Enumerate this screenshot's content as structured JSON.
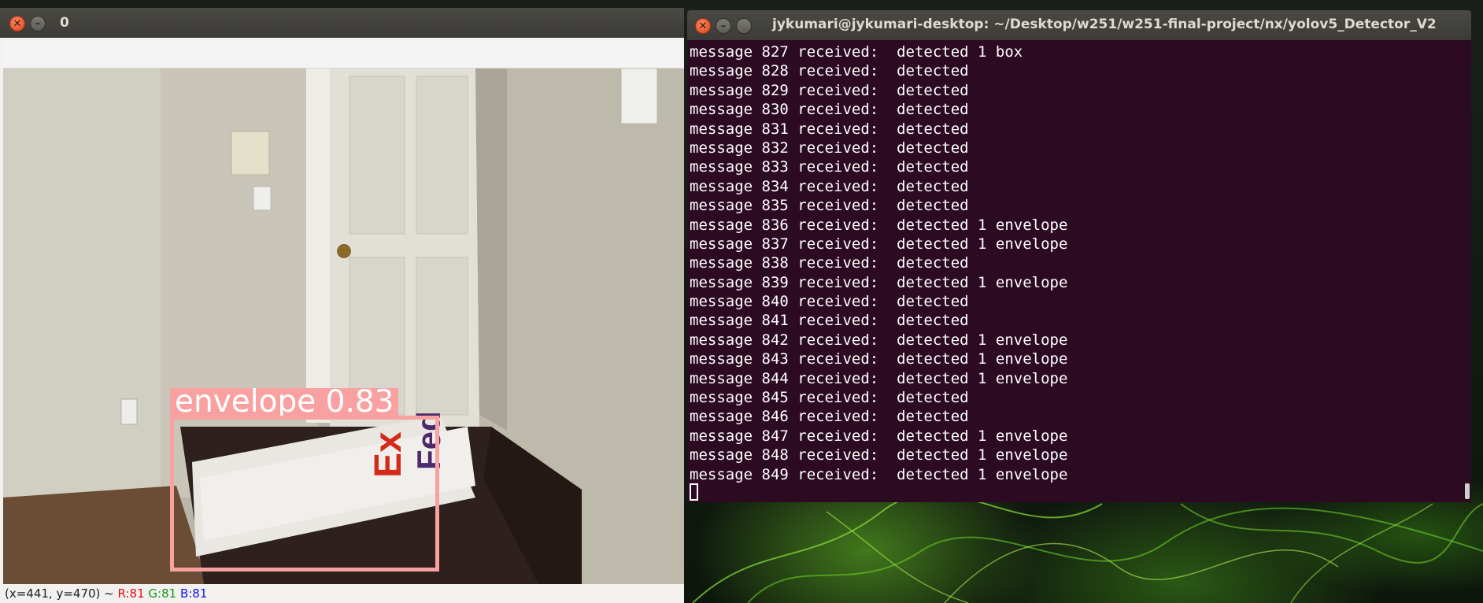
{
  "viewer": {
    "title": "0",
    "close_glyph": "✕",
    "minimize_glyph": "–",
    "detection": {
      "label": "envelope 0.83",
      "color": "#f8a1a0"
    },
    "status": {
      "coords": "(x=441, y=470) ~",
      "r": "R:81",
      "g": "G:81",
      "b": "B:81"
    }
  },
  "terminal": {
    "title": "jykumari@jykumari-desktop: ~/Desktop/w251/w251-final-project/nx/yolov5_Detector_V2",
    "background": "#2c0a22",
    "lines": [
      "message 827 received:  detected 1 box",
      "message 828 received:  detected",
      "message 829 received:  detected",
      "message 830 received:  detected",
      "message 831 received:  detected",
      "message 832 received:  detected",
      "message 833 received:  detected",
      "message 834 received:  detected",
      "message 835 received:  detected",
      "message 836 received:  detected 1 envelope",
      "message 837 received:  detected 1 envelope",
      "message 838 received:  detected",
      "message 839 received:  detected 1 envelope",
      "message 840 received:  detected",
      "message 841 received:  detected",
      "message 842 received:  detected 1 envelope",
      "message 843 received:  detected 1 envelope",
      "message 844 received:  detected 1 envelope",
      "message 845 received:  detected",
      "message 846 received:  detected",
      "message 847 received:  detected 1 envelope",
      "message 848 received:  detected 1 envelope",
      "message 849 received:  detected 1 envelope"
    ]
  },
  "icons": {
    "close": "close-icon",
    "minimize": "minimize-icon",
    "maximize": "maximize-icon"
  }
}
